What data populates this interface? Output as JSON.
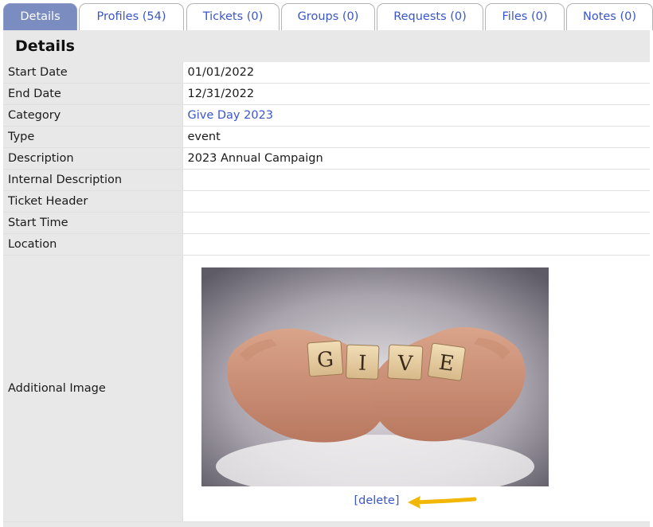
{
  "tabs": [
    {
      "label": "Details",
      "active": true
    },
    {
      "label": "Profiles (54)",
      "active": false
    },
    {
      "label": "Tickets (0)",
      "active": false
    },
    {
      "label": "Groups (0)",
      "active": false
    },
    {
      "label": "Requests (0)",
      "active": false
    },
    {
      "label": "Files (0)",
      "active": false
    },
    {
      "label": "Notes (0)",
      "active": false
    }
  ],
  "panel": {
    "title": "Details",
    "rows": [
      {
        "label": "Start Date",
        "value": "01/01/2022"
      },
      {
        "label": "End Date",
        "value": "12/31/2022"
      },
      {
        "label": "Category",
        "value": "Give Day 2023",
        "link": true
      },
      {
        "label": "Type",
        "value": "event"
      },
      {
        "label": "Description",
        "value": "2023 Annual Campaign"
      },
      {
        "label": "Internal Description",
        "value": ""
      },
      {
        "label": "Ticket Header",
        "value": ""
      },
      {
        "label": "Start Time",
        "value": ""
      },
      {
        "label": "Location",
        "value": ""
      }
    ],
    "image_row": {
      "label": "Additional Image",
      "image_tiles": [
        "G",
        "I",
        "V",
        "E"
      ],
      "delete_label": "[delete]",
      "arrow_color": "#f2b705"
    }
  },
  "colors": {
    "tab_active_bg": "#7b8cc1",
    "link": "#3a56c9",
    "panel_bg": "#e8e8e8"
  }
}
